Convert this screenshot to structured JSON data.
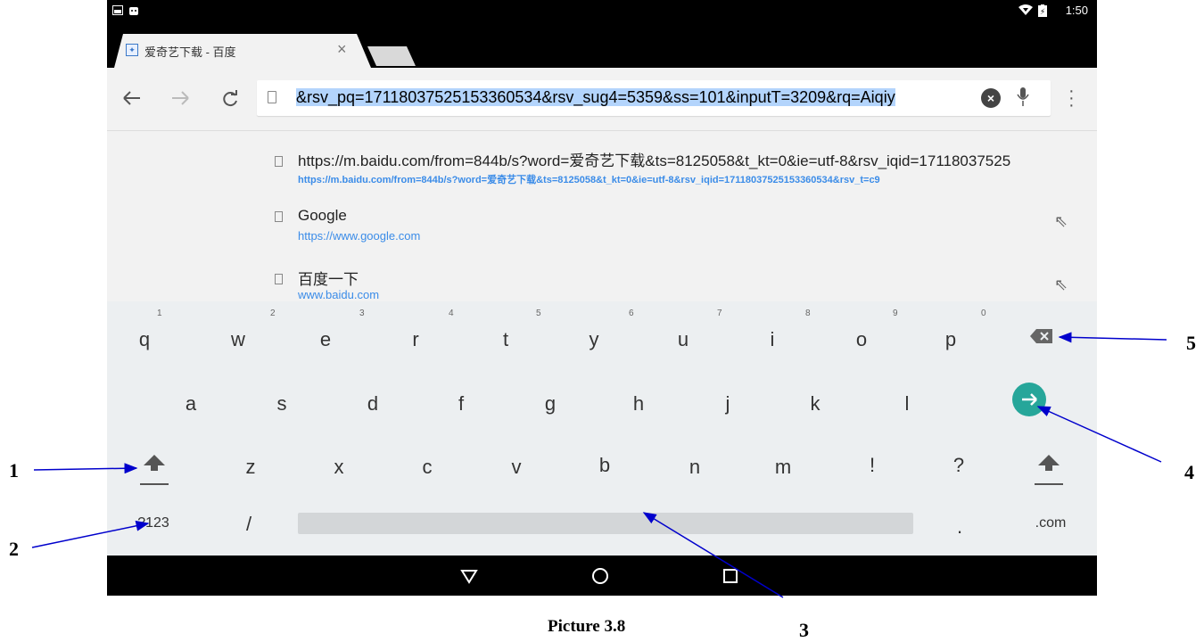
{
  "status_bar": {
    "time": "1:50",
    "left_icons": [
      "image-notification-icon",
      "android-icon"
    ],
    "right_icons": [
      "wifi-icon",
      "battery-icon"
    ]
  },
  "browser": {
    "tab_title": "爱奇艺下载 - 百度",
    "tab_close": "×",
    "address_text_selected": "&rsv_pq=17118037525153360534&rsv_sug4=5359&ss=101&inputT=3209&rq=Aiqiy"
  },
  "suggestions": [
    {
      "title": "https://m.baidu.com/from=844b/s?word=爱奇艺下载&ts=8125058&t_kt=0&ie=utf-8&rsv_iqid=17118037525",
      "url": "https://m.baidu.com/from=844b/s?word=爱奇艺下载&ts=8125058&t_kt=0&ie=utf-8&rsv_iqid=17118037525153360534&rsv_t=c9"
    },
    {
      "title": "Google",
      "url": "https://www.google.com"
    },
    {
      "title": "百度一下",
      "url": "www.baidu.com"
    }
  ],
  "keyboard": {
    "row1": [
      "q",
      "w",
      "e",
      "r",
      "t",
      "y",
      "u",
      "i",
      "o",
      "p"
    ],
    "row1_hints": [
      "1",
      "2",
      "3",
      "4",
      "5",
      "6",
      "7",
      "8",
      "9",
      "0"
    ],
    "row2": [
      "a",
      "s",
      "d",
      "f",
      "g",
      "h",
      "j",
      "k",
      "l"
    ],
    "row3": [
      "z",
      "x",
      "c",
      "v",
      "b",
      "n",
      "m",
      "!",
      "?"
    ],
    "row4": {
      "symbols": "?123",
      "slash": "/",
      "period": ".",
      "com": ".com"
    },
    "accent_color": "#26a69a"
  },
  "annotations": {
    "caption": "Picture 3.8",
    "callouts": [
      "1",
      "2",
      "3",
      "4",
      "5"
    ]
  }
}
